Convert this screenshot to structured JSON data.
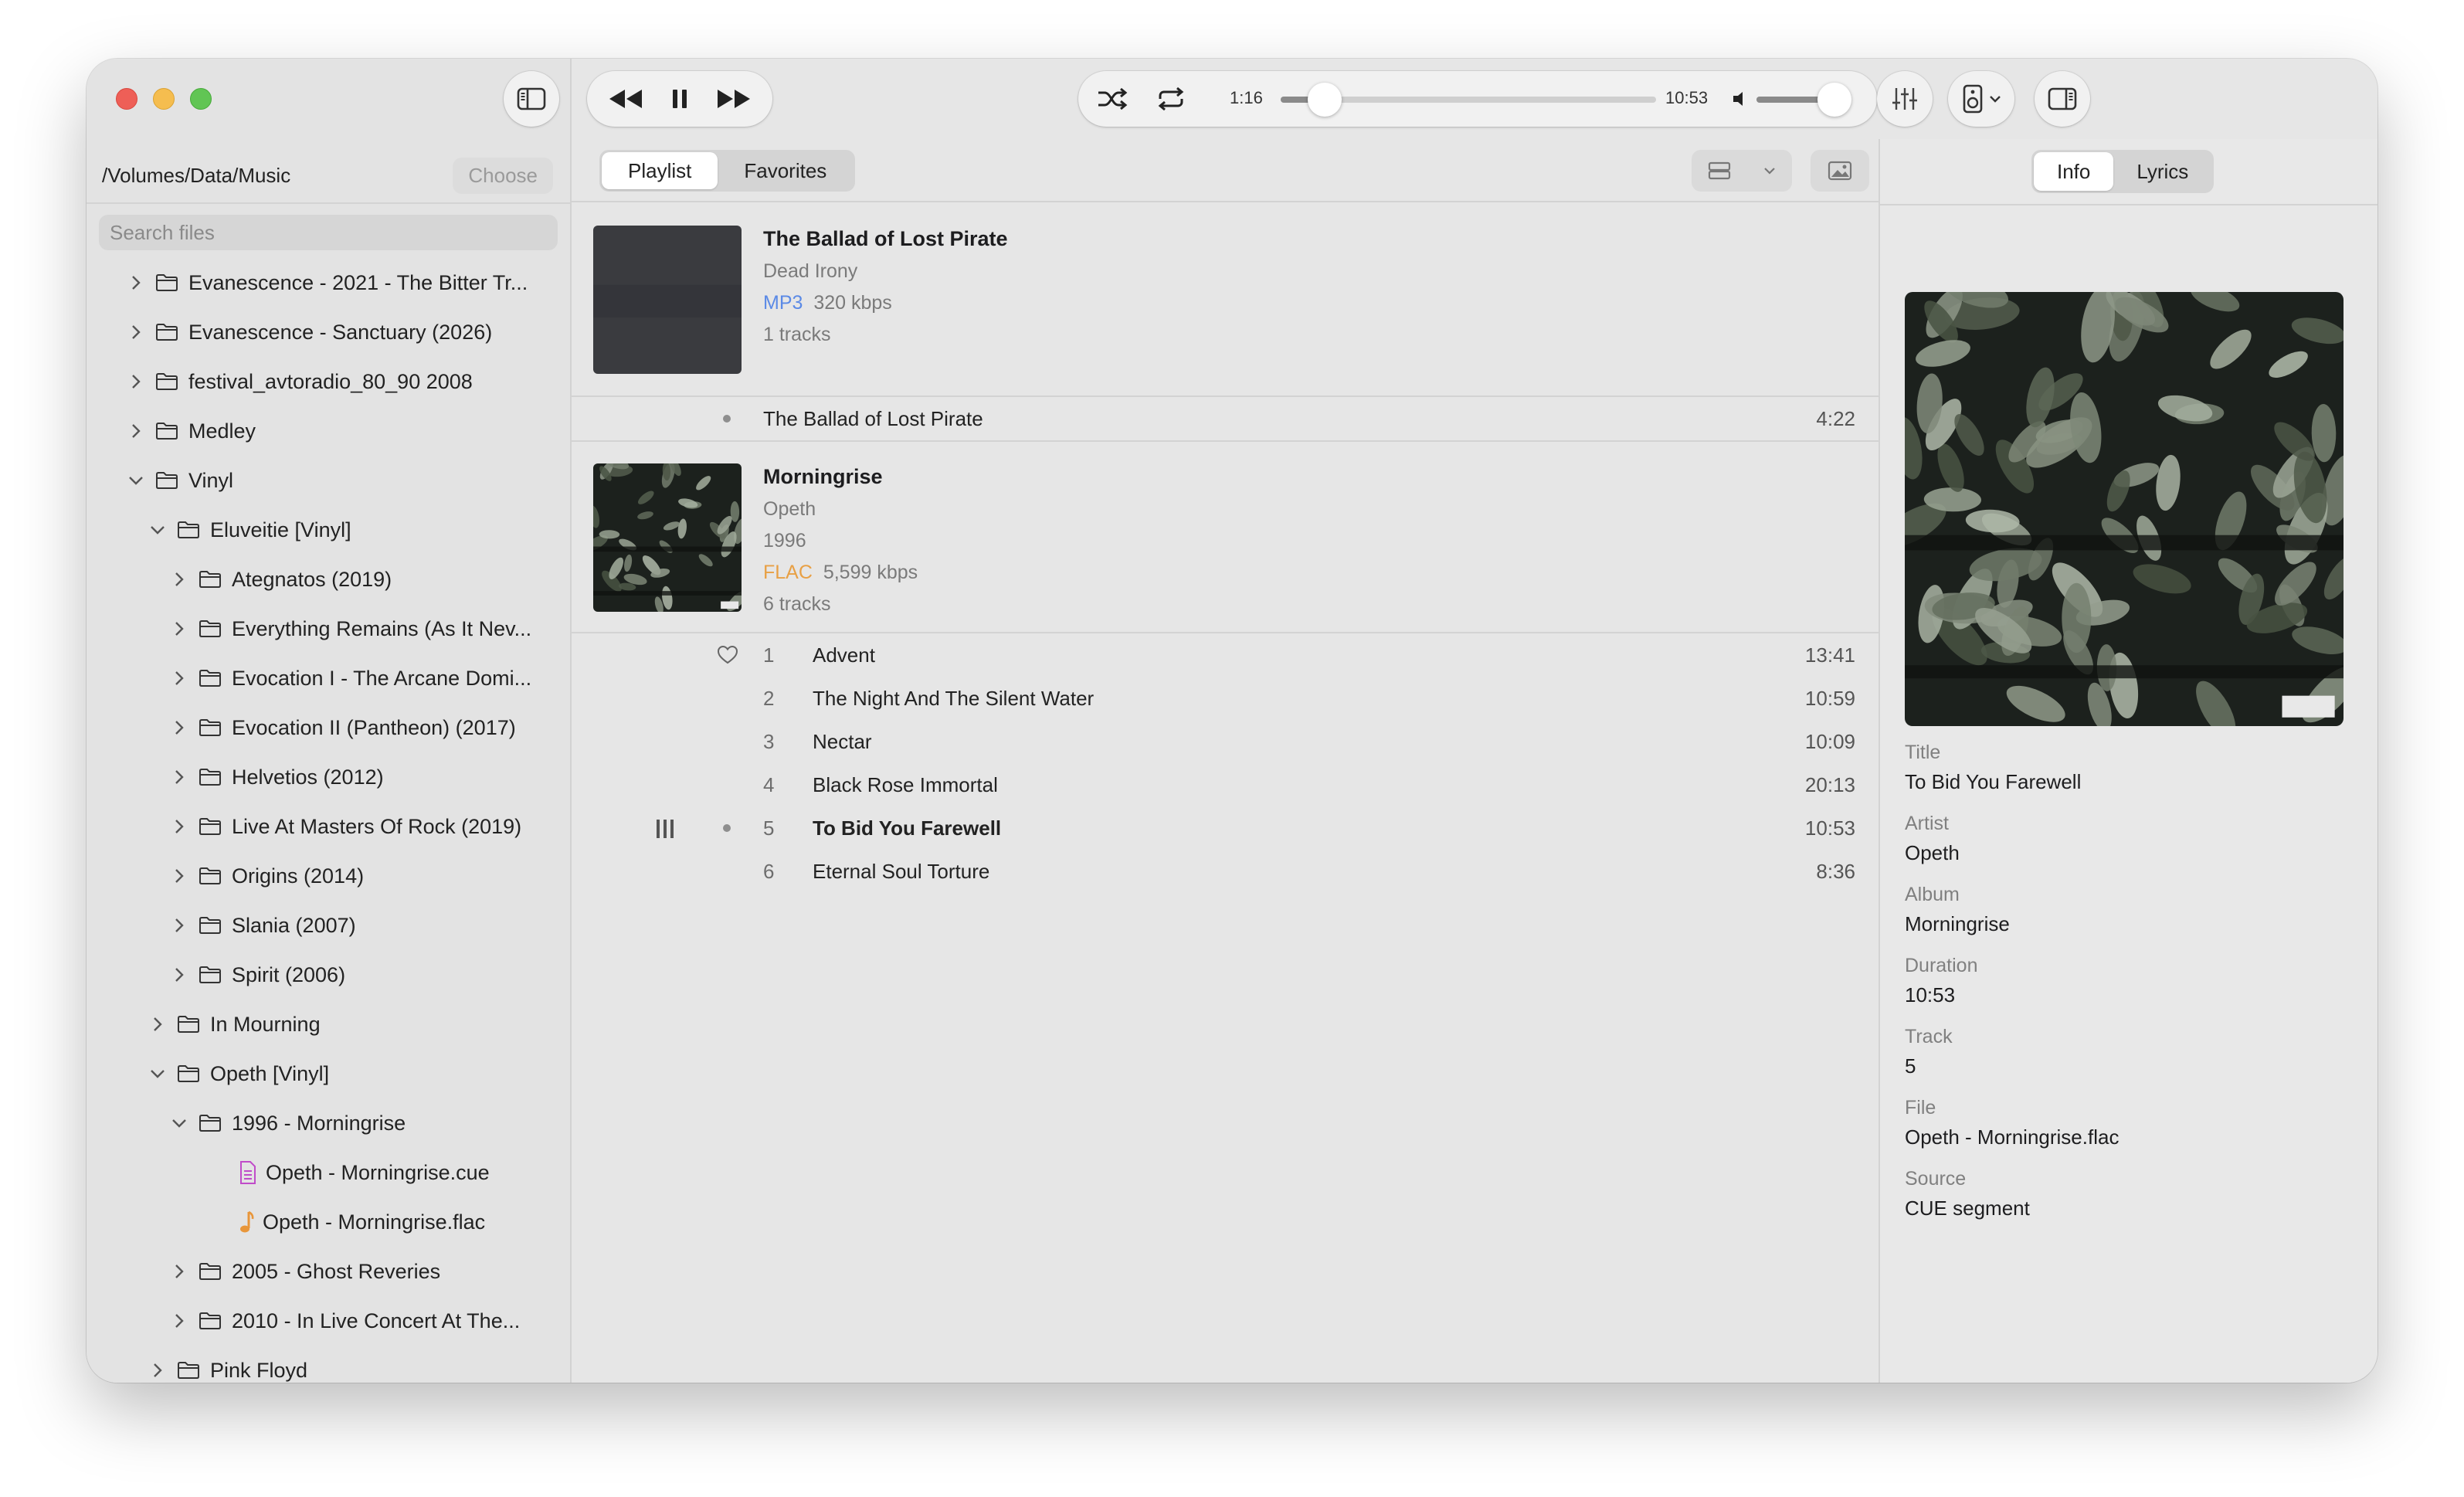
{
  "sidebar": {
    "path": "/Volumes/Data/Music",
    "choose_label": "Choose",
    "search_placeholder": "Search files",
    "tree": [
      {
        "label": "Evanescence - 2021 - The Bitter Tr...",
        "depth": 0,
        "expanded": false,
        "kind": "folder"
      },
      {
        "label": "Evanescence - Sanctuary (2026)",
        "depth": 0,
        "expanded": false,
        "kind": "folder"
      },
      {
        "label": "festival_avtoradio_80_90 2008",
        "depth": 0,
        "expanded": false,
        "kind": "folder"
      },
      {
        "label": "Medley",
        "depth": 0,
        "expanded": false,
        "kind": "folder"
      },
      {
        "label": "Vinyl",
        "depth": 0,
        "expanded": true,
        "kind": "folder"
      },
      {
        "label": "Eluveitie [Vinyl]",
        "depth": 1,
        "expanded": true,
        "kind": "folder"
      },
      {
        "label": "Ategnatos (2019)",
        "depth": 2,
        "expanded": false,
        "kind": "folder"
      },
      {
        "label": "Everything Remains (As It Nev...",
        "depth": 2,
        "expanded": false,
        "kind": "folder"
      },
      {
        "label": "Evocation I - The Arcane Domi...",
        "depth": 2,
        "expanded": false,
        "kind": "folder"
      },
      {
        "label": "Evocation II (Pantheon) (2017)",
        "depth": 2,
        "expanded": false,
        "kind": "folder"
      },
      {
        "label": "Helvetios (2012)",
        "depth": 2,
        "expanded": false,
        "kind": "folder"
      },
      {
        "label": "Live At Masters Of Rock (2019)",
        "depth": 2,
        "expanded": false,
        "kind": "folder"
      },
      {
        "label": "Origins (2014)",
        "depth": 2,
        "expanded": false,
        "kind": "folder"
      },
      {
        "label": "Slania (2007)",
        "depth": 2,
        "expanded": false,
        "kind": "folder"
      },
      {
        "label": "Spirit (2006)",
        "depth": 2,
        "expanded": false,
        "kind": "folder"
      },
      {
        "label": "In Mourning",
        "depth": 1,
        "expanded": false,
        "kind": "folder"
      },
      {
        "label": "Opeth [Vinyl]",
        "depth": 1,
        "expanded": true,
        "kind": "folder"
      },
      {
        "label": "1996 - Morningrise",
        "depth": 2,
        "expanded": true,
        "kind": "folder"
      },
      {
        "label": "Opeth - Morningrise.cue",
        "depth": 3,
        "kind": "cue"
      },
      {
        "label": "Opeth - Morningrise.flac",
        "depth": 3,
        "kind": "audio"
      },
      {
        "label": "2005 - Ghost Reveries",
        "depth": 2,
        "expanded": false,
        "kind": "folder"
      },
      {
        "label": "2010 - In Live Concert At The...",
        "depth": 2,
        "expanded": false,
        "kind": "folder"
      },
      {
        "label": "Pink Floyd",
        "depth": 1,
        "expanded": false,
        "kind": "folder"
      }
    ]
  },
  "player": {
    "current_time": "1:16",
    "total_time": "10:53",
    "progress": 0.117,
    "volume": 0.87
  },
  "main": {
    "tabs": [
      {
        "label": "Playlist",
        "active": true
      },
      {
        "label": "Favorites",
        "active": false
      }
    ],
    "albums": [
      {
        "title": "The Ballad of Lost Pirate",
        "artist": "Dead Irony",
        "year": "",
        "format": "MP3",
        "bitrate": "320 kbps",
        "track_count": "1 tracks",
        "cover": "dark",
        "tracks": [
          {
            "num": "",
            "title": "The Ballad of Lost Pirate",
            "duration": "4:22",
            "dot": true,
            "heart": false,
            "playing": false
          }
        ]
      },
      {
        "title": "Morningrise",
        "artist": "Opeth",
        "year": "1996",
        "format": "FLAC",
        "bitrate": "5,599 kbps",
        "track_count": "6 tracks",
        "cover": "leaves",
        "tracks": [
          {
            "num": "1",
            "title": "Advent",
            "duration": "13:41",
            "dot": false,
            "heart": true,
            "playing": false
          },
          {
            "num": "2",
            "title": "The Night And The Silent Water",
            "duration": "10:59",
            "dot": false,
            "heart": false,
            "playing": false
          },
          {
            "num": "3",
            "title": "Nectar",
            "duration": "10:09",
            "dot": false,
            "heart": false,
            "playing": false
          },
          {
            "num": "4",
            "title": "Black Rose Immortal",
            "duration": "20:13",
            "dot": false,
            "heart": false,
            "playing": false
          },
          {
            "num": "5",
            "title": "To Bid You Farewell",
            "duration": "10:53",
            "dot": true,
            "heart": false,
            "playing": true
          },
          {
            "num": "6",
            "title": "Eternal Soul Torture",
            "duration": "8:36",
            "dot": false,
            "heart": false,
            "playing": false
          }
        ]
      }
    ]
  },
  "inspector": {
    "tabs": [
      {
        "label": "Info",
        "active": true
      },
      {
        "label": "Lyrics",
        "active": false
      }
    ],
    "fields": [
      {
        "label": "Title",
        "value": "To Bid You Farewell"
      },
      {
        "label": "Artist",
        "value": "Opeth"
      },
      {
        "label": "Album",
        "value": "Morningrise"
      },
      {
        "label": "Duration",
        "value": "10:53"
      },
      {
        "label": "Track",
        "value": "5"
      },
      {
        "label": "File",
        "value": "Opeth - Morningrise.flac"
      },
      {
        "label": "Source",
        "value": "CUE segment"
      }
    ]
  },
  "colors": {
    "mp3": "#5b8ae6",
    "flac": "#e8a045",
    "cue_icon": "#c04cc9",
    "audio_icon": "#e8963a",
    "traffic_red": "#ee5f57",
    "traffic_yellow": "#f5bd4f",
    "traffic_green": "#61c554"
  }
}
